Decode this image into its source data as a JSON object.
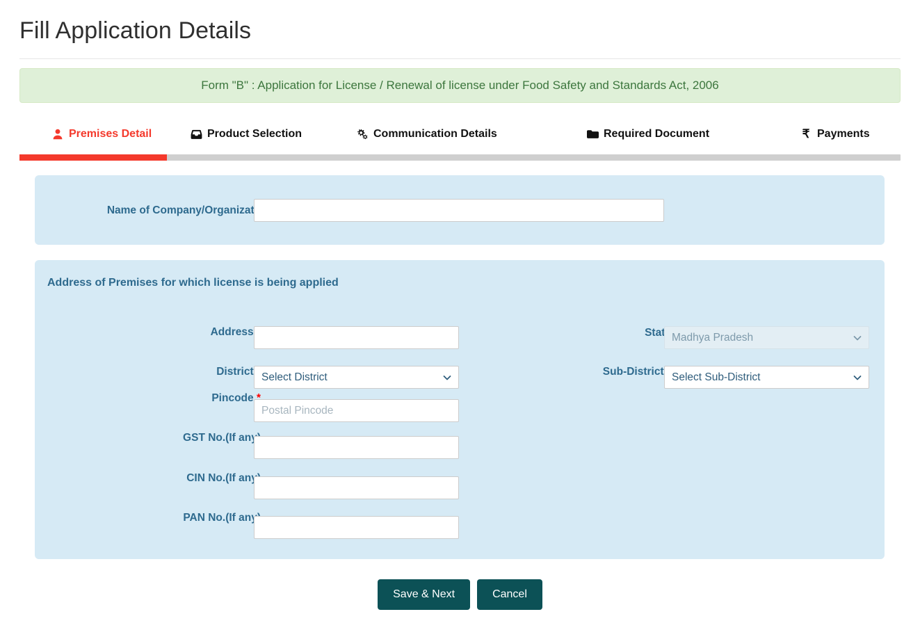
{
  "header": {
    "title": "Fill Application Details",
    "banner_text": "Form \"B\" : Application for License / Renewal of license under Food Safety and Standards Act, 2006",
    "banner_bg": "#dff0d8",
    "banner_color": "#3c763d"
  },
  "tabs": {
    "active_color": "#f4392c",
    "inactive_color": "#111111",
    "items": [
      {
        "label": "Premises Detail",
        "icon": "user-icon",
        "active": true
      },
      {
        "label": "Product Selection",
        "icon": "inbox-icon",
        "active": false
      },
      {
        "label": "Communication Details",
        "icon": "cogs-icon",
        "active": false
      },
      {
        "label": "Required Document",
        "icon": "folder-icon",
        "active": false
      },
      {
        "label": "Payments",
        "icon": "rupee-icon",
        "active": false
      }
    ]
  },
  "company_panel": {
    "label": "Name of Company/Organization",
    "required_mark": "*",
    "value": "",
    "placeholder": ""
  },
  "address_panel": {
    "heading": "Address of Premises for which license is being applied",
    "fields": {
      "address": {
        "label": "Address",
        "required_mark": "*",
        "value": "",
        "placeholder": ""
      },
      "district": {
        "label": "District",
        "required_mark": "*",
        "value": "Select District"
      },
      "pincode": {
        "label": "Pincode",
        "required_mark": "*",
        "value": "",
        "placeholder": "Postal Pincode"
      },
      "gst": {
        "label": "GST No.(If any)",
        "required_mark": "",
        "value": "",
        "placeholder": ""
      },
      "cin": {
        "label": "CIN No.(If any)",
        "required_mark": "",
        "value": "",
        "placeholder": ""
      },
      "pan": {
        "label": "PAN No.(If any)",
        "required_mark": "",
        "value": "",
        "placeholder": ""
      },
      "state": {
        "label": "State",
        "required_mark": "",
        "value": "Madhya Pradesh",
        "disabled": true
      },
      "sub_district": {
        "label": "Sub-District",
        "required_mark": "*",
        "value": "Select Sub-District"
      }
    }
  },
  "actions": {
    "save_label": "Save & Next",
    "cancel_label": "Cancel",
    "button_color": "#0c5156"
  }
}
